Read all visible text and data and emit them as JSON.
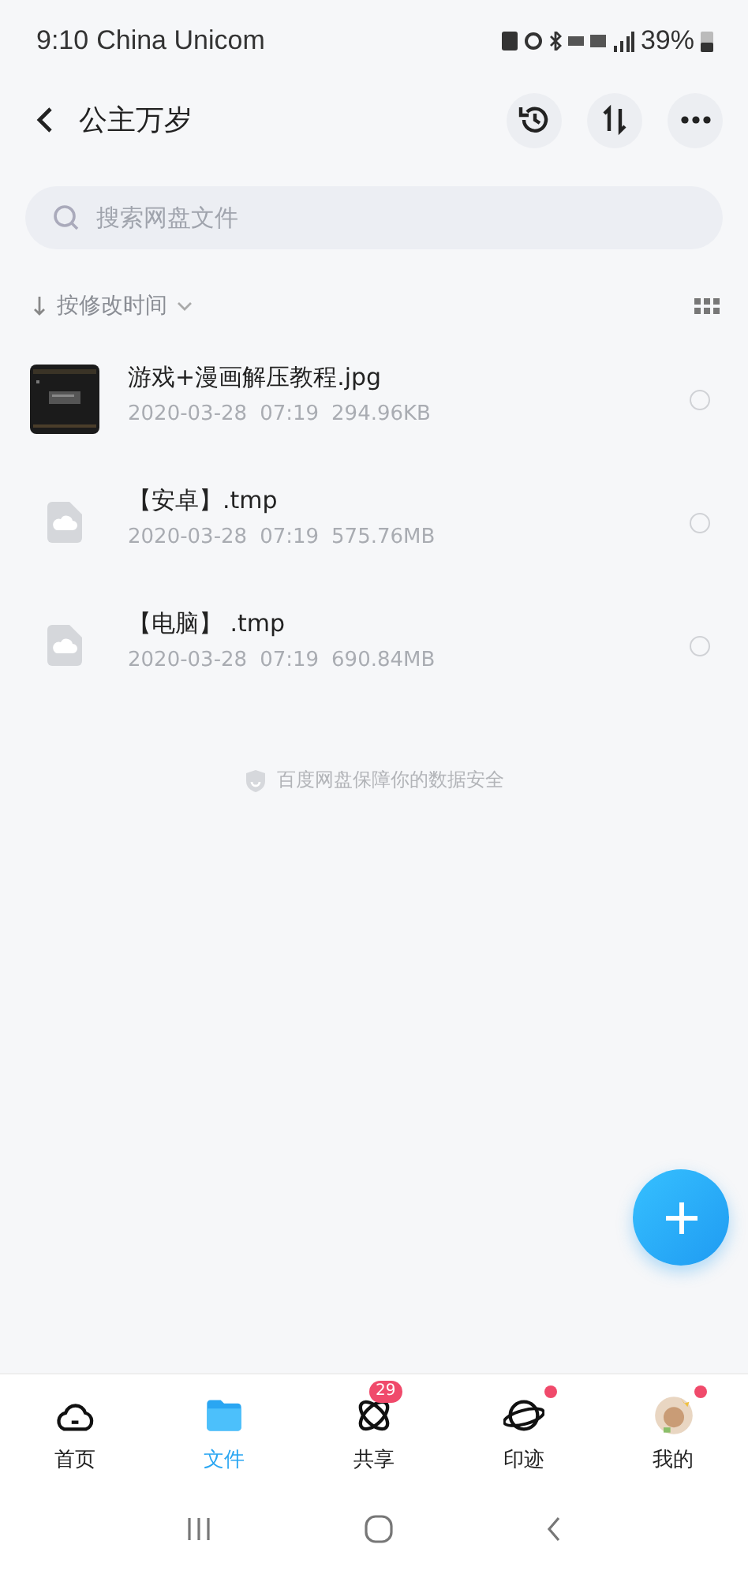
{
  "status_bar": {
    "time": "9:10",
    "carrier": "China Unicom",
    "battery": "39%"
  },
  "header": {
    "title": "公主万岁"
  },
  "search": {
    "placeholder": "搜索网盘文件"
  },
  "sort": {
    "label": "按修改时间"
  },
  "files": [
    {
      "name": "游戏+漫画解压教程.jpg",
      "date": "2020-03-28",
      "time": "07:19",
      "size": "294.96KB",
      "selected": false
    },
    {
      "kind": "file",
      "name": "【安卓】.tmp",
      "date": "2020-03-28",
      "time": "07:19",
      "size": "575.76MB",
      "selected": false
    },
    {
      "kind": "file",
      "name": "【电脑】 .tmp",
      "date": "2020-03-28",
      "time": "07:19",
      "size": "690.84MB",
      "selected": false
    }
  ],
  "footer_note": "百度网盘保障你的数据安全",
  "tabs": [
    {
      "kind": "home",
      "label": "首页",
      "selected": false
    },
    {
      "kind": "files",
      "label": "文件",
      "selected": true
    },
    {
      "kind": "share",
      "label": "共享",
      "selected": false,
      "badge": "29"
    },
    {
      "kind": "moments",
      "label": "印迹",
      "selected": false,
      "dot": true
    },
    {
      "kind": "me",
      "label": "我的",
      "selected": false,
      "dot": true
    }
  ]
}
